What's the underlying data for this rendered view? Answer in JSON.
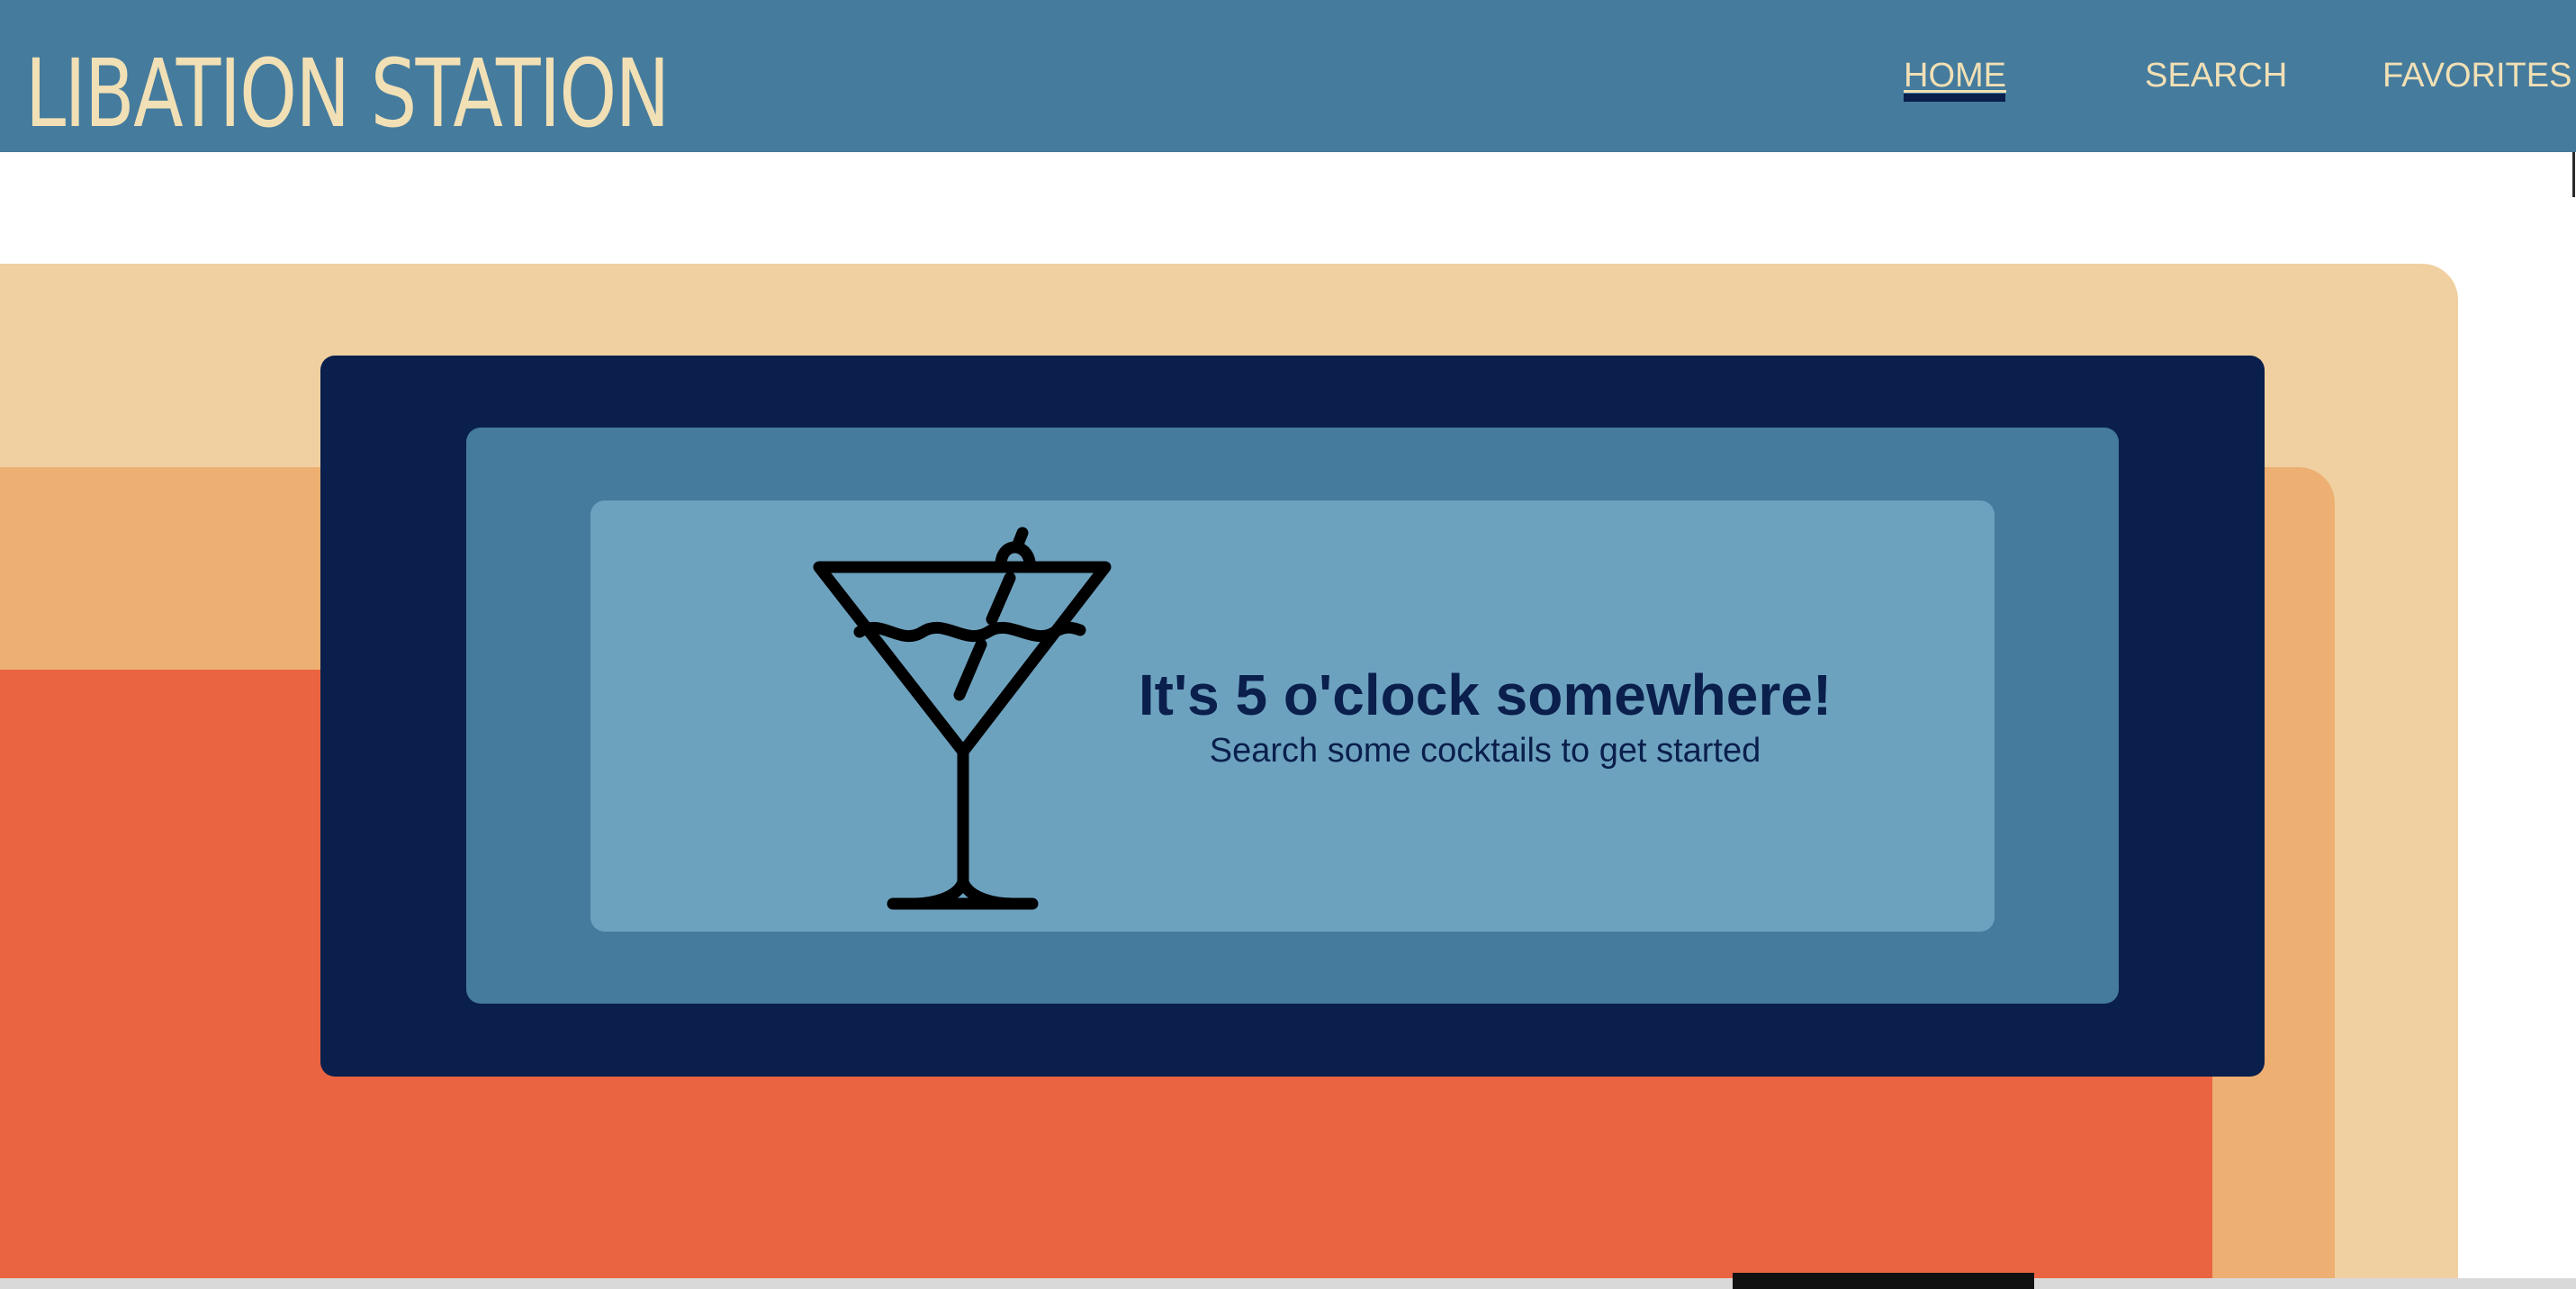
{
  "header": {
    "logo": "LIBATION STATION",
    "nav": [
      {
        "label": "HOME",
        "active": true
      },
      {
        "label": "SEARCH",
        "active": false
      },
      {
        "label": "FAVORITES",
        "active": false
      }
    ]
  },
  "hero": {
    "icon": "martini-glass-icon",
    "title": "It's 5 o'clock somewhere!",
    "subtitle": "Search some cocktails to get started"
  },
  "colors": {
    "header_bg": "#457b9d",
    "header_text": "#f1e0b5",
    "navy": "#0a1f4c",
    "steel_blue": "#457b9d",
    "sky_blue": "#6da2bf",
    "beige": "#f0d0a0",
    "tan": "#edaf72",
    "red_orange": "#ea6442"
  }
}
